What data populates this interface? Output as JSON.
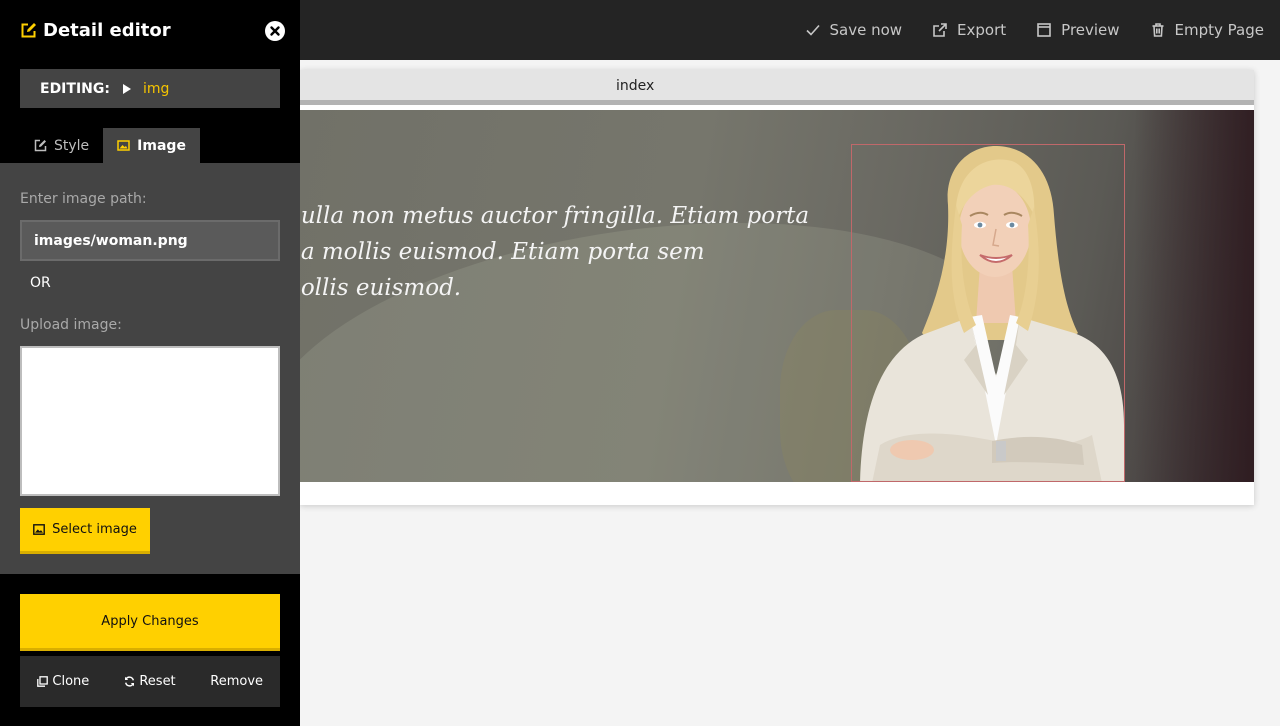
{
  "topbar": {
    "actions": [
      {
        "label": "Save now",
        "icon": "check-icon"
      },
      {
        "label": "Export",
        "icon": "export-icon"
      },
      {
        "label": "Preview",
        "icon": "window-icon"
      },
      {
        "label": "Empty Page",
        "icon": "trash-icon"
      }
    ]
  },
  "preview": {
    "tab_label": "index",
    "hero_text": "nulla non metus auctor fringilla. Etiam porta\nna mollis euismod. Etiam porta sem\nnollis euismod."
  },
  "sidebar": {
    "title": "Detail editor",
    "editing_label": "EDITING:",
    "editing_target": "img",
    "tabs": [
      {
        "label": "Style",
        "active": false
      },
      {
        "label": "Image",
        "active": true
      }
    ],
    "image_path_label": "Enter image path:",
    "image_path_value": "images/woman.png",
    "or_text": "OR",
    "upload_label": "Upload image:",
    "select_image_label": "Select image",
    "apply_label": "Apply Changes",
    "actions": [
      {
        "label": "Clone",
        "icon": "clone-icon"
      },
      {
        "label": "Reset",
        "icon": "refresh-icon"
      },
      {
        "label": "Remove",
        "icon": ""
      }
    ]
  },
  "colors": {
    "accent": "#ffd000",
    "editing_target": "#f5c400",
    "sidebar_bg": "#000000",
    "panel_bg": "#444444",
    "topbar_bg": "#242424",
    "selection_outline": "#c0686a"
  }
}
